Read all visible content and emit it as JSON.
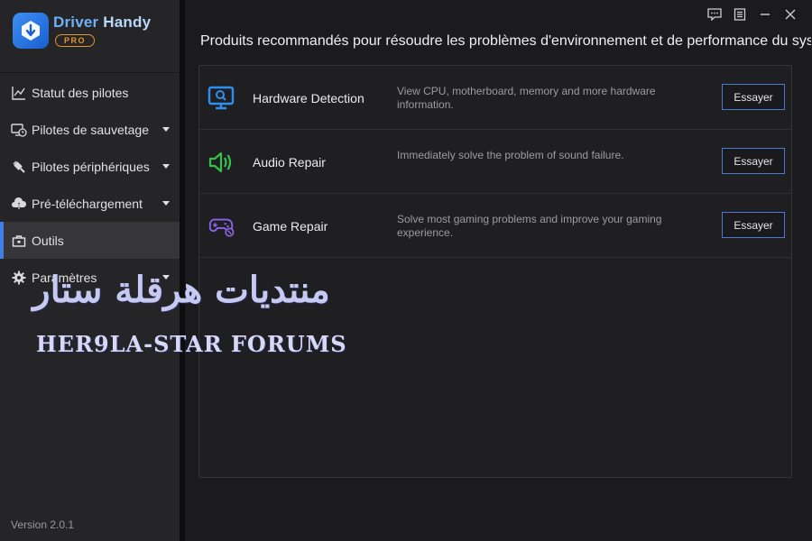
{
  "app": {
    "name_part1": "Driver",
    "name_part2": "Handy",
    "badge": "PRO",
    "version": "Version 2.0.1"
  },
  "sidebar": {
    "items": [
      {
        "label": "Statut des pilotes",
        "icon": "chart-icon",
        "has_submenu": false,
        "active": false
      },
      {
        "label": "Pilotes de sauvetage",
        "icon": "monitor-clock-icon",
        "has_submenu": true,
        "active": false
      },
      {
        "label": "Pilotes périphériques",
        "icon": "plug-icon",
        "has_submenu": true,
        "active": false
      },
      {
        "label": "Pré-téléchargement",
        "icon": "cloud-download-icon",
        "has_submenu": true,
        "active": false
      },
      {
        "label": "Outils",
        "icon": "toolbox-icon",
        "has_submenu": false,
        "active": true
      },
      {
        "label": "Paramètres",
        "icon": "gear-icon",
        "has_submenu": true,
        "active": false
      }
    ]
  },
  "window_controls": [
    "feedback-icon",
    "menu-icon",
    "minimize-icon",
    "close-icon"
  ],
  "main": {
    "title": "Produits recommandés pour résoudre les problèmes d'environnement et de performance du sys..."
  },
  "tools": [
    {
      "name": "Hardware Detection",
      "description": "View CPU, motherboard, memory and more hardware information.",
      "button": "Essayer",
      "icon": "hardware-monitor-icon",
      "icon_color": "#2f8ff0"
    },
    {
      "name": "Audio Repair",
      "description": "Immediately solve the problem of sound failure.",
      "button": "Essayer",
      "icon": "speaker-icon",
      "icon_color": "#36c24a"
    },
    {
      "name": "Game Repair",
      "description": "Solve most gaming problems and improve your gaming experience.",
      "button": "Essayer",
      "icon": "gamepad-icon",
      "icon_color": "#8a63e8"
    }
  ],
  "watermark": {
    "arabic": "منتديات هرقلة ستار",
    "latin": "HER9LA-STAR FORUMS"
  },
  "colors": {
    "accent": "#3f7fe6",
    "sidebar_bg": "#252528",
    "main_bg": "#1b1b1d",
    "badge": "#e2962c"
  }
}
